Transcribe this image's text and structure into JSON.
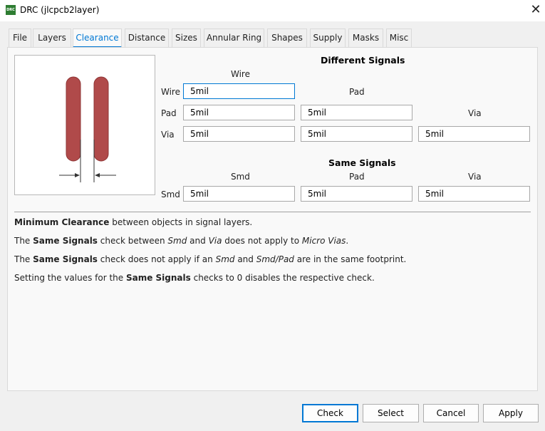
{
  "window": {
    "title": "DRC (jlcpcb2layer)",
    "icon": "drc-app-icon",
    "icon_text": "DRC"
  },
  "tabs": [
    "File",
    "Layers",
    "Clearance",
    "Distance",
    "Sizes",
    "Annular Ring",
    "Shapes",
    "Supply",
    "Masks",
    "Misc"
  ],
  "active_tab": "Clearance",
  "different_signals": {
    "title": "Different Signals",
    "col_wire": "Wire",
    "col_pad": "Pad",
    "col_via": "Via",
    "row_wire": "Wire",
    "row_pad": "Pad",
    "row_via": "Via",
    "wire_wire": "5mil",
    "pad_wire": "5mil",
    "pad_pad": "5mil",
    "via_wire": "5mil",
    "via_pad": "5mil",
    "via_via": "5mil"
  },
  "same_signals": {
    "title": "Same Signals",
    "col_smd": "Smd",
    "col_pad": "Pad",
    "col_via": "Via",
    "row_smd": "Smd",
    "smd_smd": "5mil",
    "smd_pad": "5mil",
    "smd_via": "5mil"
  },
  "notes": {
    "n1_b": "Minimum Clearance",
    "n1_t": " between objects in signal layers.",
    "n2_a": "The ",
    "n2_b": "Same Signals",
    "n2_c": " check between ",
    "n2_d": "Smd",
    "n2_e": " and ",
    "n2_f": "Via",
    "n2_g": " does not apply to ",
    "n2_h": "Micro Vias",
    "n2_i": ".",
    "n3_a": "The ",
    "n3_b": "Same Signals",
    "n3_c": " check does not apply if an ",
    "n3_d": "Smd",
    "n3_e": " and ",
    "n3_f": "Smd/Pad",
    "n3_g": " are in the same footprint.",
    "n4_a": "Setting the values for the ",
    "n4_b": "Same Signals",
    "n4_c": " checks to 0 disables the respective check."
  },
  "buttons": {
    "check": "Check",
    "select": "Select",
    "cancel": "Cancel",
    "apply": "Apply"
  },
  "colors": {
    "accent": "#0078d4",
    "pad_fill": "#b04a4a",
    "pad_stroke": "#8e3535"
  }
}
